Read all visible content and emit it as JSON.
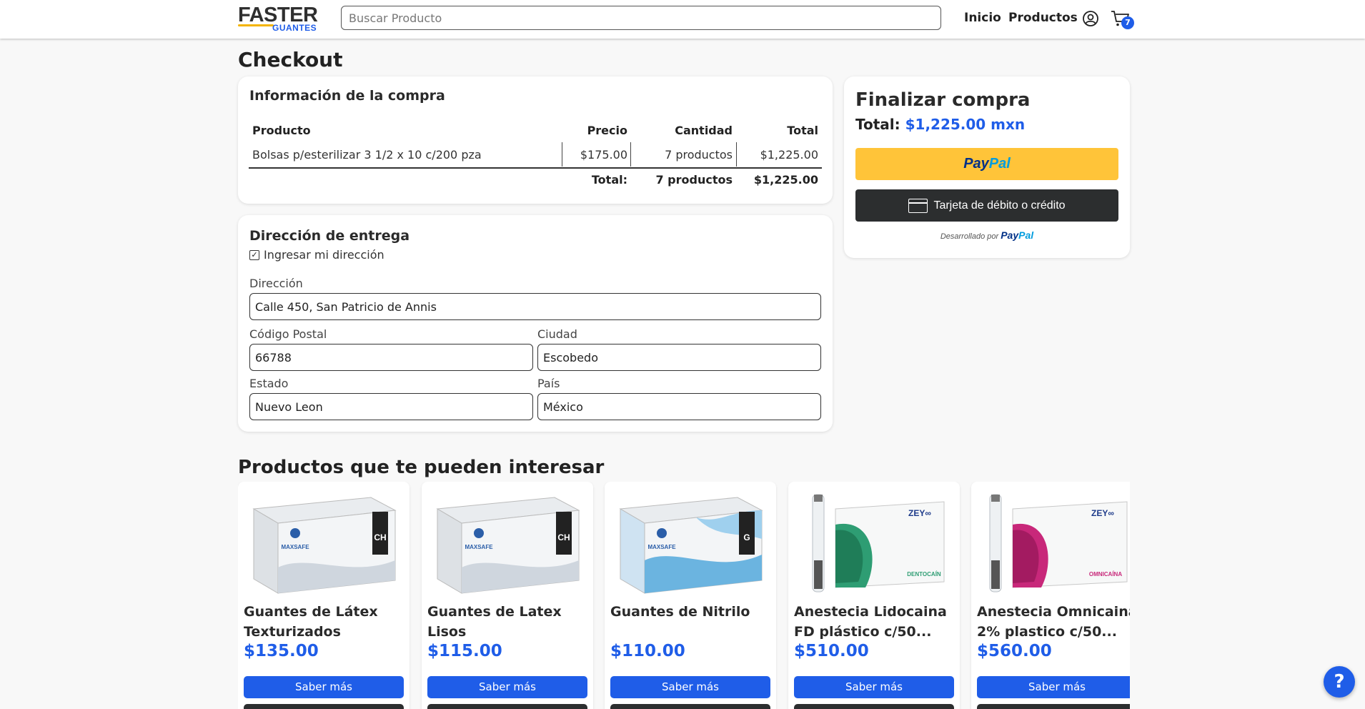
{
  "header": {
    "logo_main": "FASTER",
    "logo_sub": "GUANTES",
    "search_placeholder": "Buscar Producto",
    "nav_inicio": "Inicio",
    "nav_productos": "Productos",
    "cart_count": "7"
  },
  "page_title": "Checkout",
  "purchase": {
    "title": "Información de la compra",
    "headers": {
      "product": "Producto",
      "price": "Precio",
      "qty": "Cantidad",
      "total": "Total"
    },
    "rows": [
      {
        "product": "Bolsas p/esterilizar 3 1/2 x 10 c/200 pza",
        "price": "$175.00",
        "qty": "7 productos",
        "total": "$1,225.00"
      }
    ],
    "footer": {
      "label": "Total:",
      "qty": "7 productos",
      "total": "$1,225.00"
    }
  },
  "address": {
    "title": "Dirección de entrega",
    "checkbox_label": "Ingresar mi dirección",
    "checkbox_checked": true,
    "fields": {
      "direccion": {
        "label": "Dirección",
        "value": "Calle 450, San Patricio de Annis"
      },
      "cp": {
        "label": "Código Postal",
        "value": "66788"
      },
      "ciudad": {
        "label": "Ciudad",
        "value": "Escobedo"
      },
      "estado": {
        "label": "Estado",
        "value": "Nuevo Leon"
      },
      "pais": {
        "label": "País",
        "value": "México"
      }
    }
  },
  "checkout": {
    "title": "Finalizar compra",
    "total_label": "Total:",
    "total_value": "$1,225.00 mxn",
    "paypal_a": "Pay",
    "paypal_b": "Pal",
    "card_button": "Tarjeta de débito o crédito",
    "powered_by": "Desarrollado por",
    "powered_a": "Pay",
    "powered_b": "Pal"
  },
  "recommendations": {
    "title": "Productos que te pueden interesar",
    "button_label": "Saber más",
    "products": [
      {
        "name": "Guantes de Látex Texturizados",
        "price": "$135.00"
      },
      {
        "name": "Guantes de Latex Lisos",
        "price": "$115.00"
      },
      {
        "name": "Guantes de Nitrilo",
        "price": "$110.00"
      },
      {
        "name": "Anestecia Lidocaina FD plástico c/50...",
        "price": "$510.00"
      },
      {
        "name": "Anestecia Omnicaina 2% plastico c/50...",
        "price": "$560.00"
      }
    ]
  },
  "help_button": "?",
  "colors": {
    "accent": "#1f5de8",
    "paypal_yellow": "#ffc439",
    "dark_button": "#2c2e2f"
  },
  "icons": {
    "user": "user-circle-icon",
    "cart": "shopping-cart-icon",
    "card": "credit-card-icon"
  }
}
